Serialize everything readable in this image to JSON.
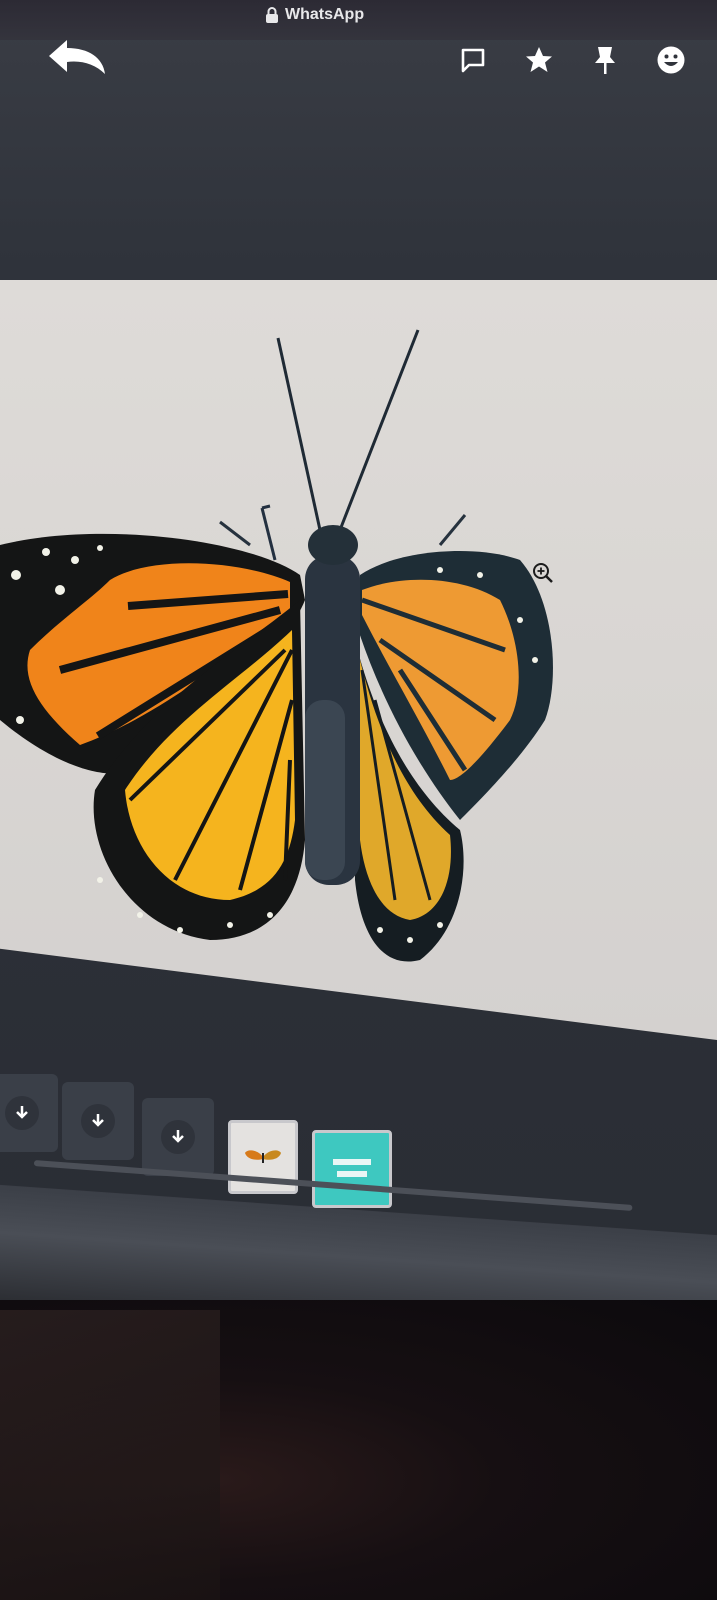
{
  "app": {
    "title": "WhatsApp"
  },
  "icons": {
    "lock": "lock-icon",
    "back": "reply-arrow-icon",
    "message": "message-square-icon",
    "star": "star-icon",
    "pin": "pin-icon",
    "emoji": "smiley-icon",
    "zoom": "zoom-in-icon",
    "download": "download-arrow-icon"
  },
  "colors": {
    "titlebar": "#2c2a34",
    "screen_frame": "#2f333b",
    "viewer_bg": "#dcd9d6",
    "wing_orange": "#f08a1c",
    "wing_yellow": "#f5b41e",
    "wing_black": "#141515",
    "thumb_teal": "#3ec8c0"
  },
  "thumbnails": [
    {
      "type": "download"
    },
    {
      "type": "download"
    },
    {
      "type": "download"
    },
    {
      "type": "image",
      "subject": "butterfly",
      "selected": true
    },
    {
      "type": "image",
      "subject": "teal-document",
      "selected": false
    }
  ]
}
